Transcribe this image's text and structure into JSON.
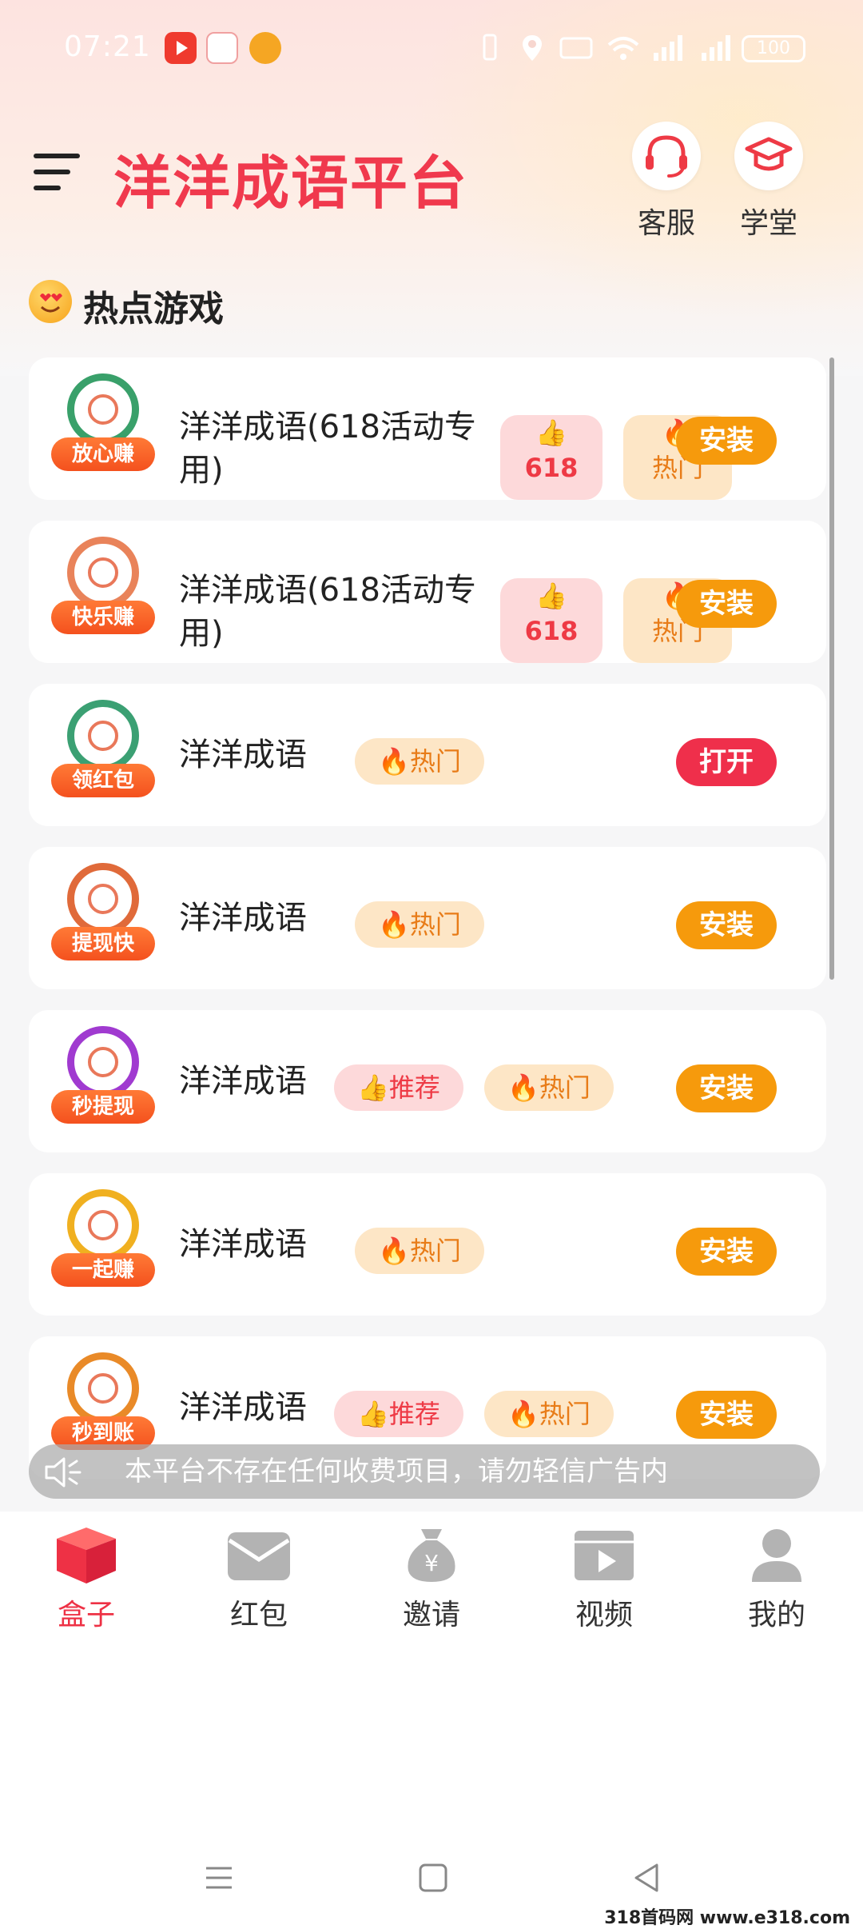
{
  "status_bar": {
    "time": "07:21",
    "battery": "100",
    "icons": [
      "video-app-icon",
      "gift-app-icon",
      "pet-app-icon",
      "vibrate-icon",
      "location-icon",
      "hd-icon",
      "wifi-icon",
      "signal-icon",
      "signal-icon",
      "battery-icon"
    ]
  },
  "header": {
    "menu_icon": "menu-icon",
    "title": "洋洋成语平台",
    "service_label": "客服",
    "school_label": "学堂"
  },
  "section": {
    "title": "热点游戏",
    "emoji": "heart-eyes-emoji"
  },
  "games": [
    {
      "badge": "放心赚",
      "name": "洋洋成语(618活动专用)",
      "tag_618": "618",
      "tag_hot": "热门",
      "action": "安装"
    },
    {
      "badge": "快乐赚",
      "name": "洋洋成语(618活动专用)",
      "tag_618": "618",
      "tag_hot": "热门",
      "action": "安装"
    },
    {
      "badge": "领红包",
      "name": "洋洋成语",
      "tag_hot": "热门",
      "action": "打开"
    },
    {
      "badge": "提现快",
      "name": "洋洋成语",
      "tag_hot": "热门",
      "action": "安装"
    },
    {
      "badge": "秒提现",
      "name": "洋洋成语",
      "tag_rec": "推荐",
      "tag_hot": "热门",
      "action": "安装"
    },
    {
      "badge": "一起赚",
      "name": "洋洋成语",
      "tag_hot": "热门",
      "action": "安装"
    },
    {
      "badge": "秒到账",
      "name": "洋洋成语",
      "tag_rec": "推荐",
      "tag_hot": "热门",
      "action": "安装"
    }
  ],
  "notice": {
    "text": "本平台不存在任何收费项目，请勿轻信广告内"
  },
  "tabs": [
    {
      "label": "盒子",
      "icon": "box-icon",
      "active": true
    },
    {
      "label": "红包",
      "icon": "envelope-icon",
      "active": false
    },
    {
      "label": "邀请",
      "icon": "money-bag-icon",
      "active": false
    },
    {
      "label": "视频",
      "icon": "video-icon",
      "active": false
    },
    {
      "label": "我的",
      "icon": "user-icon",
      "active": false
    }
  ],
  "watermark": "318首码网 www.e318.com",
  "colors": {
    "brand": "#f0394d",
    "install": "#f69a0c",
    "open": "#ef2f4b",
    "hot_bg": "#fde6c6",
    "rec_bg": "#fdd9da"
  }
}
